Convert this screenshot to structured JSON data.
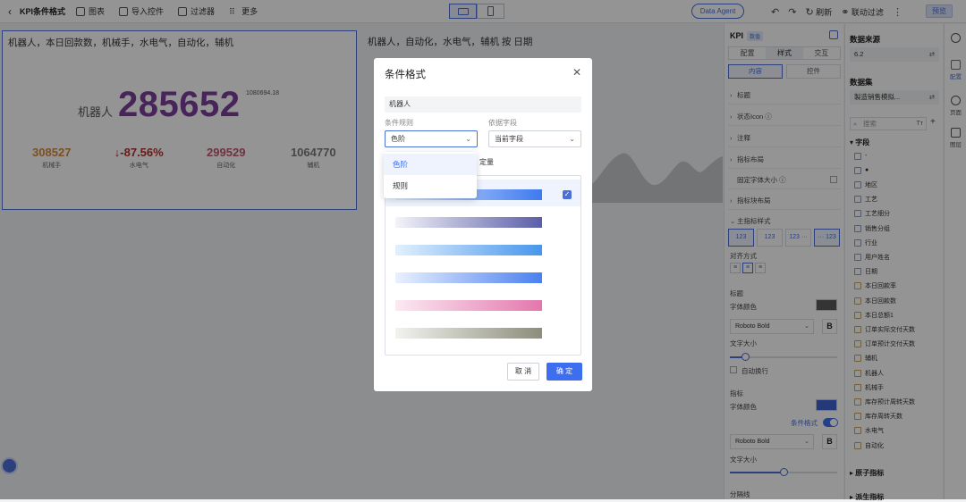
{
  "toolbar": {
    "back_icon": "chevron-left-icon",
    "title": "KPI条件格式",
    "chart_label": "图表",
    "import_label": "导入控件",
    "filter_label": "过滤器",
    "more_label": "更多",
    "agent_label": "Data Agent",
    "refresh_label": "刷新",
    "link_filter_label": "联动过滤",
    "preview_label": "预览"
  },
  "kpi": {
    "title": "机器人，本日回款数，机械手，水电气，自动化，辅机",
    "main_label": "机器人",
    "main_value": "285652",
    "main_value_color": "#7b3f9a",
    "sub_value": "1080694.18",
    "minis": [
      {
        "value": "308527",
        "label": "机械手",
        "color": "#d4883a"
      },
      {
        "value": "↓-87.56%",
        "label": "水电气",
        "color": "#b0302d"
      },
      {
        "value": "299529",
        "label": "自动化",
        "color": "#c0576e"
      },
      {
        "value": "1064770",
        "label": "辅机",
        "color": "#7a7a7a"
      }
    ]
  },
  "chart2": {
    "title": "机器人，自动化，水电气，辅机 按 日期"
  },
  "dialog": {
    "title": "条件格式",
    "close_icon": "close-icon",
    "field_value": "机器人",
    "rule_label": "条件规则",
    "rule_value": "色阶",
    "basis_label": "依据字段",
    "basis_value": "当前字段",
    "partial_text": "定量",
    "dropdown_options": [
      "色阶",
      "规则"
    ],
    "gradients": [
      {
        "from": "#dfeafd",
        "to": "#3e7af0",
        "selected": true
      },
      {
        "from": "#f3f3f8",
        "to": "#5a5ea8",
        "selected": false
      },
      {
        "from": "#e2f0fd",
        "to": "#4796ec",
        "selected": false
      },
      {
        "from": "#eaf1fe",
        "to": "#4b80f0",
        "selected": false
      },
      {
        "from": "#fbeaf2",
        "to": "#e377ad",
        "selected": false
      },
      {
        "from": "#f2f3ef",
        "to": "#8d8d7c",
        "selected": false
      }
    ],
    "cancel_label": "取 消",
    "ok_label": "确 定"
  },
  "config": {
    "header": "KPI",
    "header_tag": "数值",
    "tabs": [
      "配置",
      "样式",
      "交互"
    ],
    "active_tab": "样式",
    "subtabs": [
      "内容",
      "控件"
    ],
    "sections": [
      "标题",
      "状态Icon ⓘ",
      "注释",
      "指标布局"
    ],
    "fixed_font_label": "固定字体大小 ⓘ",
    "sub_layout_label": "指标块布局",
    "main_style_label": "主指标样式",
    "style_options": [
      "123",
      "123",
      "123 ···",
      "··· 123"
    ],
    "align_label": "对齐方式",
    "title_group_label": "标题",
    "font_color_label": "字体颜色",
    "title_color": "#5a5a5a",
    "font_name": "Roboto Bold",
    "bold_label": "B",
    "font_size_label": "文字大小",
    "title_size_fraction": 0.14,
    "auto_wrap_label": "自动换行",
    "metric_group_label": "指标",
    "metric_font_color_label": "字体颜色",
    "metric_color": "#3e62d2",
    "cond_format_label": "条件格式",
    "metric_font_name": "Roboto Bold",
    "metric_bold_label": "B",
    "metric_size_label": "文字大小",
    "metric_size_fraction": 0.5,
    "divider_label": "分隔线"
  },
  "datapanel": {
    "source_header": "数据来源",
    "source_value": "6.2",
    "dataset_header": "数据集",
    "dataset_value": "製造销售模拟...",
    "search_placeholder": "搜索",
    "fields_header": "字段",
    "fields": [
      {
        "name": "-",
        "measure": false
      },
      {
        "name": "●",
        "measure": false
      },
      {
        "name": "地区",
        "measure": false
      },
      {
        "name": "工艺",
        "measure": false
      },
      {
        "name": "工艺细分",
        "measure": false
      },
      {
        "name": "销售分组",
        "measure": false
      },
      {
        "name": "行业",
        "measure": false
      },
      {
        "name": "用户姓名",
        "measure": false
      },
      {
        "name": "日期",
        "measure": false
      },
      {
        "name": "本日回款率",
        "measure": true
      },
      {
        "name": "本日回款数",
        "measure": true
      },
      {
        "name": "本日总额1",
        "measure": true
      },
      {
        "name": "订单实际交付天数",
        "measure": true
      },
      {
        "name": "订单预计交付天数",
        "measure": true
      },
      {
        "name": "辅机",
        "measure": true
      },
      {
        "name": "机器人",
        "measure": true
      },
      {
        "name": "机械手",
        "measure": true
      },
      {
        "name": "库存预计周转天数",
        "measure": true
      },
      {
        "name": "库存周转天数",
        "measure": true
      },
      {
        "name": "水电气",
        "measure": true
      },
      {
        "name": "自动化",
        "measure": true
      }
    ],
    "atomic_header": "原子指标",
    "derived_header": "派生指标"
  },
  "strip": {
    "items": [
      "",
      "配置",
      "页面",
      "图层"
    ]
  }
}
